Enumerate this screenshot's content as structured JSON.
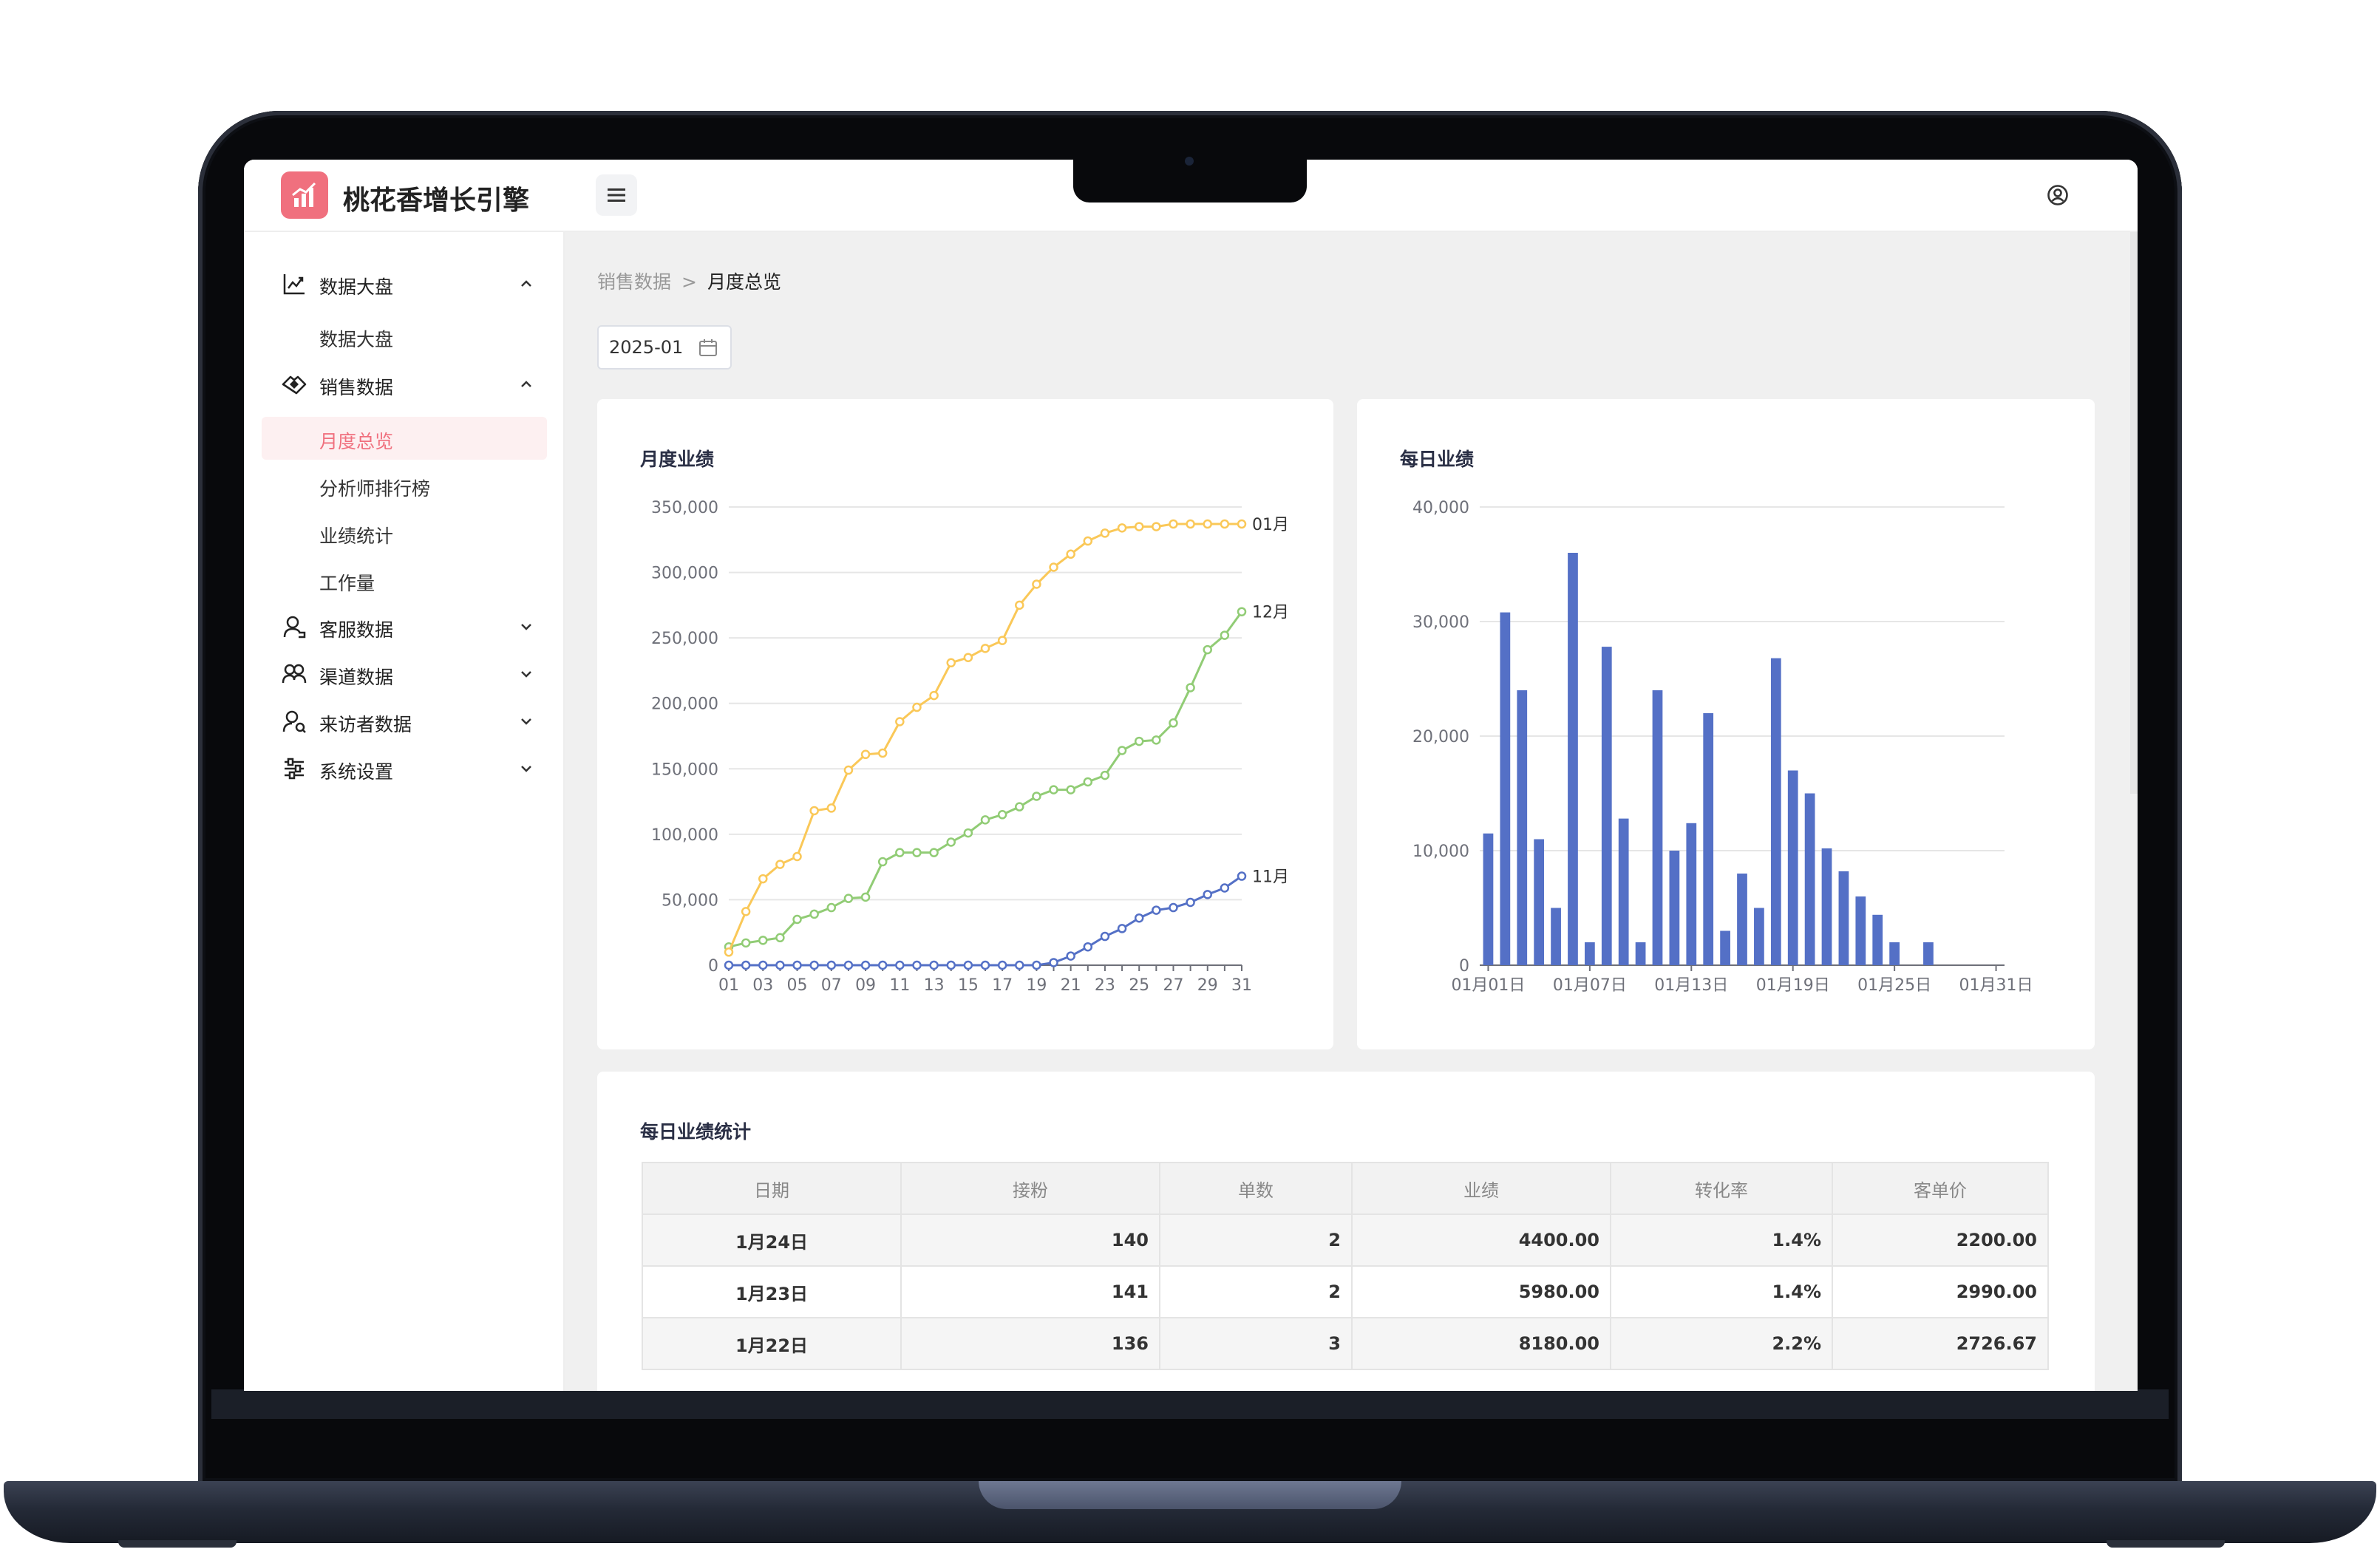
{
  "app": {
    "title": "桃花香增长引擎"
  },
  "sidebar": {
    "groups": [
      {
        "label": "数据大盘",
        "icon": "line-chart-icon",
        "expanded": true,
        "items": [
          {
            "label": "数据大盘",
            "active": false
          }
        ]
      },
      {
        "label": "销售数据",
        "icon": "handshake-icon",
        "expanded": true,
        "items": [
          {
            "label": "月度总览",
            "active": true
          },
          {
            "label": "分析师排行榜",
            "active": false
          },
          {
            "label": "业绩统计",
            "active": false
          },
          {
            "label": "工作量",
            "active": false
          }
        ]
      },
      {
        "label": "客服数据",
        "icon": "customer-service-icon",
        "expanded": false
      },
      {
        "label": "渠道数据",
        "icon": "users-icon",
        "expanded": false
      },
      {
        "label": "来访者数据",
        "icon": "visitor-icon",
        "expanded": false
      },
      {
        "label": "系统设置",
        "icon": "sliders-icon",
        "expanded": false
      }
    ]
  },
  "breadcrumb": {
    "parent": "销售数据",
    "separator": ">",
    "current": "月度总览"
  },
  "date_picker": {
    "value": "2025-01"
  },
  "monthly_card": {
    "title": "月度业绩"
  },
  "daily_card": {
    "title": "每日业绩"
  },
  "table_card": {
    "title": "每日业绩统计",
    "columns": [
      "日期",
      "接粉",
      "单数",
      "业绩",
      "转化率",
      "客单价"
    ],
    "rows": [
      [
        "1月24日",
        "140",
        "2",
        "4400.00",
        "1.4%",
        "2200.00"
      ],
      [
        "1月23日",
        "141",
        "2",
        "5980.00",
        "1.4%",
        "2990.00"
      ],
      [
        "1月22日",
        "136",
        "3",
        "8180.00",
        "2.2%",
        "2726.67"
      ]
    ]
  },
  "colors": {
    "accent": "#f0707e",
    "series_nov": "#5470c6",
    "series_dec": "#91cc75",
    "series_jan": "#fac858",
    "bar": "#5470c6"
  },
  "chart_data": [
    {
      "type": "line",
      "title": "月度业绩",
      "x": [
        "01",
        "02",
        "03",
        "04",
        "05",
        "06",
        "07",
        "08",
        "09",
        "10",
        "11",
        "12",
        "13",
        "14",
        "15",
        "16",
        "17",
        "18",
        "19",
        "20",
        "21",
        "22",
        "23",
        "24",
        "25",
        "26",
        "27",
        "28",
        "29",
        "30",
        "31"
      ],
      "x_tick_labels": [
        "01",
        "03",
        "05",
        "07",
        "09",
        "11",
        "13",
        "15",
        "17",
        "19",
        "21",
        "23",
        "25",
        "27",
        "29",
        "31"
      ],
      "ylim": [
        0,
        350000
      ],
      "y_ticks": [
        "0",
        "50,000",
        "100,000",
        "150,000",
        "200,000",
        "250,000",
        "300,000",
        "350,000"
      ],
      "series": [
        {
          "name": "11月",
          "color": "#5470c6",
          "values": [
            0,
            0,
            0,
            0,
            0,
            0,
            0,
            0,
            0,
            0,
            0,
            0,
            0,
            0,
            0,
            0,
            0,
            0,
            0,
            2000,
            7000,
            14000,
            22000,
            28000,
            36000,
            42000,
            44000,
            48000,
            54000,
            59000,
            68000
          ]
        },
        {
          "name": "12月",
          "color": "#91cc75",
          "values": [
            14000,
            17000,
            19000,
            21000,
            35000,
            39000,
            44000,
            51000,
            52000,
            79000,
            86000,
            86000,
            86000,
            94000,
            101000,
            111000,
            115000,
            121000,
            129000,
            134000,
            134000,
            140000,
            145000,
            164000,
            171000,
            172000,
            185000,
            212000,
            241000,
            252000,
            270000
          ]
        },
        {
          "name": "01月",
          "color": "#fac858",
          "values": [
            10000,
            41000,
            66000,
            77000,
            83000,
            118000,
            120000,
            149000,
            161000,
            162000,
            186000,
            197000,
            206000,
            231000,
            235000,
            242000,
            248000,
            275000,
            291000,
            304000,
            314000,
            324000,
            330000,
            334000,
            335000,
            335000,
            337000,
            337000,
            337000,
            337000,
            337000
          ]
        }
      ]
    },
    {
      "type": "bar",
      "title": "每日业绩",
      "x": [
        "01月01日",
        "01月02日",
        "01月03日",
        "01月04日",
        "01月05日",
        "01月06日",
        "01月07日",
        "01月08日",
        "01月09日",
        "01月10日",
        "01月11日",
        "01月12日",
        "01月13日",
        "01月14日",
        "01月15日",
        "01月16日",
        "01月17日",
        "01月18日",
        "01月19日",
        "01月20日",
        "01月21日",
        "01月22日",
        "01月23日",
        "01月24日",
        "01月25日",
        "01月26日",
        "01月27日",
        "01月28日",
        "01月29日",
        "01月30日",
        "01月31日"
      ],
      "x_tick_labels": [
        "01月01日",
        "01月07日",
        "01月13日",
        "01月19日",
        "01月25日",
        "01月31日"
      ],
      "ylim": [
        0,
        40000
      ],
      "y_ticks": [
        "0",
        "10,000",
        "20,000",
        "30,000",
        "40,000"
      ],
      "values": [
        11500,
        30800,
        24000,
        11000,
        5000,
        36000,
        2000,
        27800,
        12800,
        2000,
        24000,
        10000,
        12400,
        22000,
        3000,
        8000,
        5000,
        26800,
        17000,
        15000,
        10200,
        8200,
        6000,
        4400,
        2000,
        0,
        2000,
        0,
        0,
        0,
        0
      ]
    }
  ]
}
